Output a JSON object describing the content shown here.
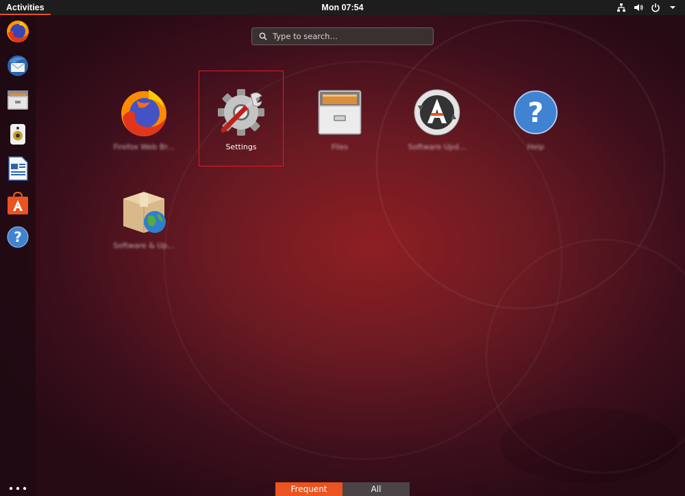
{
  "topbar": {
    "activities_label": "Activities",
    "clock": "Mon 07:54",
    "tray_icons": [
      "network-icon",
      "volume-icon",
      "power-icon",
      "menu-arrow-icon"
    ]
  },
  "dock": {
    "items": [
      {
        "name": "Firefox",
        "icon": "firefox-icon"
      },
      {
        "name": "Thunderbird",
        "icon": "thunderbird-icon"
      },
      {
        "name": "Files",
        "icon": "files-icon"
      },
      {
        "name": "Rhythmbox",
        "icon": "rhythmbox-icon"
      },
      {
        "name": "LibreOffice Writer",
        "icon": "writer-icon"
      },
      {
        "name": "Ubuntu Software",
        "icon": "software-icon"
      },
      {
        "name": "Help",
        "icon": "help-icon"
      }
    ],
    "show_apps_icon": "show-apps-grid-icon"
  },
  "search": {
    "placeholder": "Type to search…"
  },
  "apps": [
    {
      "label": "Firefox Web Br...",
      "icon": "firefox-icon",
      "blurred": true
    },
    {
      "label": "Settings",
      "icon": "settings-icon",
      "blurred": false,
      "selected": true
    },
    {
      "label": "Files",
      "icon": "files-icon",
      "blurred": true
    },
    {
      "label": "Software Upd...",
      "icon": "software-updater-icon",
      "blurred": true
    },
    {
      "label": "Help",
      "icon": "help-icon",
      "blurred": true
    },
    {
      "label": "Software & Up...",
      "icon": "software-sources-icon",
      "blurred": true
    }
  ],
  "view_switcher": {
    "frequent": "Frequent",
    "all": "All",
    "active": "Frequent"
  },
  "colors": {
    "accent": "#e95420",
    "selection_border": "#e01b24",
    "topbar": "#1d1d1d"
  }
}
